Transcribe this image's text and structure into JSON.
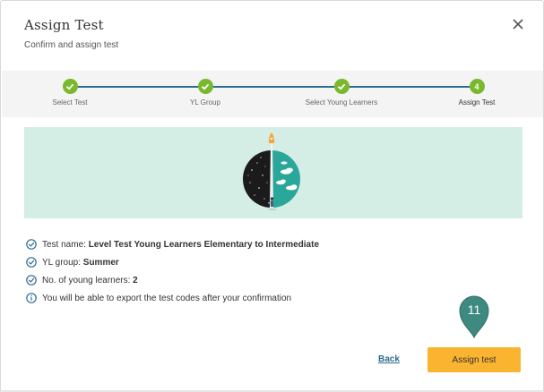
{
  "dialog": {
    "title": "Assign Test",
    "subtitle": "Confirm and assign test",
    "close_icon": "close-icon"
  },
  "stepper": {
    "steps": [
      {
        "label": "Select Test",
        "state": "done"
      },
      {
        "label": "YL Group",
        "state": "done"
      },
      {
        "label": "Select Young Learners",
        "state": "done"
      },
      {
        "label": "Assign Test",
        "state": "active",
        "number": "4"
      }
    ],
    "done_color": "#7ab82d",
    "line_color": "#2c6b8f"
  },
  "banner": {
    "background": "#d4ede5",
    "illustration": "rocket-moon-illustration"
  },
  "summary": {
    "test_name_label": "Test name: ",
    "test_name_value": "Level Test Young Learners Elementary to Intermediate",
    "group_label": "YL group: ",
    "group_value": "Summer",
    "count_label": "No. of young learners: ",
    "count_value": "2",
    "note": "You will be able to export the test codes after your confirmation"
  },
  "callout": {
    "number": "11",
    "color": "#3e8a80"
  },
  "actions": {
    "back_label": "Back",
    "assign_label": "Assign test",
    "assign_color": "#fbb42f"
  }
}
